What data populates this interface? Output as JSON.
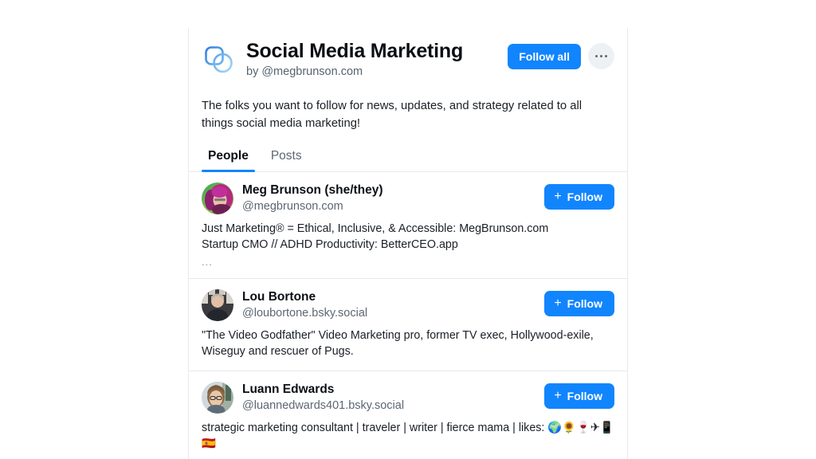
{
  "header": {
    "logo_icon": "starterpack-logo-icon",
    "title": "Social Media Marketing",
    "byline": "by @megbrunson.com",
    "follow_all_label": "Follow all",
    "more_icon": "ellipsis-icon"
  },
  "description": "The folks you want to follow for news, updates, and strategy related to all things social media marketing!",
  "tabs": [
    {
      "label": "People",
      "active": true
    },
    {
      "label": "Posts",
      "active": false
    }
  ],
  "people": [
    {
      "name": "Meg Brunson (she/they)",
      "handle": "@megbrunson.com",
      "bio": "Just Marketing® = Ethical, Inclusive, & Accessible: MegBrunson.com\nStartup CMO // ADHD Productivity: BetterCEO.app",
      "truncated": "...",
      "follow_label": "Follow",
      "follow_plus": "+",
      "avatar_alt": "avatar-meg-brunson"
    },
    {
      "name": "Lou Bortone",
      "handle": "@loubortone.bsky.social",
      "bio": "\"The Video Godfather\" Video Marketing pro, former TV exec, Hollywood-exile, Wiseguy and rescuer of Pugs.",
      "truncated": "",
      "follow_label": "Follow",
      "follow_plus": "+",
      "avatar_alt": "avatar-lou-bortone"
    },
    {
      "name": "Luann Edwards",
      "handle": "@luannedwards401.bsky.social",
      "bio": "strategic marketing consultant | traveler | writer | fierce mama | likes: 🌍🌻🍷✈📱🇪🇸",
      "truncated": "",
      "follow_label": "Follow",
      "follow_plus": "+",
      "avatar_alt": "avatar-luann-edwards"
    }
  ],
  "colors": {
    "accent": "#1185fe",
    "text_primary": "#0b0f14",
    "text_secondary": "#5c6773",
    "border": "#e6e9ee",
    "more_button_bg": "#eef1f4"
  }
}
